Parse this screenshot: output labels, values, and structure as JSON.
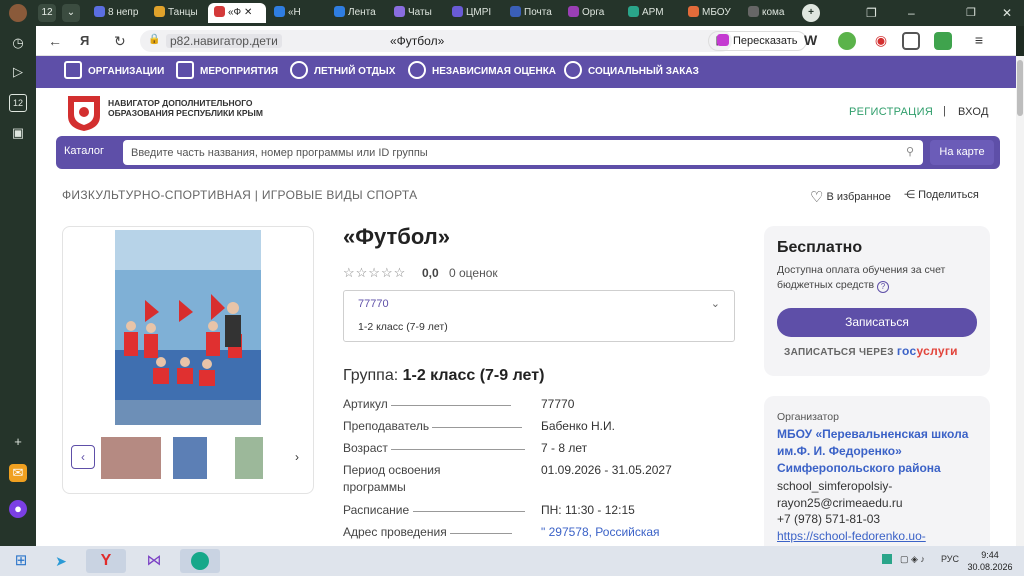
{
  "browser": {
    "tab_counter": "12",
    "tabs": [
      {
        "label": "8 непр",
        "color": "#5b6ee1"
      },
      {
        "label": "Танцы",
        "color": "#e0a22b"
      },
      {
        "label": "«Ф",
        "color": "#d43a3a"
      },
      {
        "label": "«Н",
        "color": "#2f7de1"
      },
      {
        "label": "Лента",
        "color": "#2f7de1"
      },
      {
        "label": "Чаты",
        "color": "#8a6de0"
      },
      {
        "label": "ЦМРІ",
        "color": "#6a5bd6"
      },
      {
        "label": "Почта",
        "color": "#3a5fb8"
      },
      {
        "label": "Орга",
        "color": "#9a3fb5"
      },
      {
        "label": "АРМ",
        "color": "#2aa58a"
      },
      {
        "label": "МБОУ",
        "color": "#e36b3a"
      },
      {
        "label": "кома",
        "color": "#444444"
      }
    ],
    "url_domain": "p82.навигатор.дети",
    "page_title": "«Футбол»",
    "retell_label": "Пересказать"
  },
  "site": {
    "nav": [
      "ОРГАНИЗАЦИИ",
      "МЕРОПРИЯТИЯ",
      "ЛЕТНИЙ ОТДЫХ",
      "НЕЗАВИСИМАЯ ОЦЕНКА",
      "СОЦИАЛЬНЫЙ ЗАКАЗ"
    ],
    "brand_text": "НАВИГАТОР ДОПОЛНИТЕЛЬНОГО ОБРАЗОВАНИЯ РЕСПУБЛИКИ КРЫМ",
    "register": "РЕГИСТРАЦИЯ",
    "login": "ВХОД",
    "catalog": "Каталог",
    "search_placeholder": "Введите часть названия, номер программы или ID группы",
    "on_map": "На карте"
  },
  "program": {
    "breadcrumb": "ФИЗКУЛЬТУРНО-СПОРТИВНАЯ | ИГРОВЫЕ ВИДЫ СПОРТА",
    "favorite": "В избранное",
    "share": "Поделиться",
    "title": "«Футбол»",
    "rating_value": "0,0",
    "rating_count": "0 оценок",
    "rating_stars": 0,
    "group_code": "77770",
    "group_name": "1-2 класс (7-9 лет)",
    "group_label": "Группа:",
    "group_title": "1-2 класс (7-9 лет)",
    "details": [
      {
        "k": "Артикул",
        "v": "77770"
      },
      {
        "k": "Преподаватель",
        "v": "Бабенко Н.И."
      },
      {
        "k": "Возраст",
        "v": "7 - 8 лет"
      },
      {
        "k": "Период освоения программы",
        "v": "01.09.2026 - 31.05.2027"
      },
      {
        "k": "Расписание",
        "v": "ПН: 11:30 - 12:15"
      },
      {
        "k": "Адрес проведения",
        "v": "\" 297578, Российская"
      }
    ]
  },
  "price": {
    "title": "Бесплатно",
    "desc": "Доступна оплата обучения за счет бюджетных средств",
    "enroll": "Записаться",
    "gos_prefix": "ЗАПИСАТЬСЯ ЧЕРЕЗ",
    "gos_1": "гос",
    "gos_2": "услуги"
  },
  "organizer": {
    "label": "Организатор",
    "name": "МБОУ «Перевальненская школа им.Ф. И. Федоренко» Симферопольского района",
    "email": "school_simferopolsiy-rayon25@crimeaedu.ru",
    "phone": "+7 (978) 571-81-03",
    "site": "https://school-fedorenko.uo-"
  },
  "taskbar": {
    "lang": "РУС",
    "time": "9:44",
    "date": "30.08.2026"
  }
}
